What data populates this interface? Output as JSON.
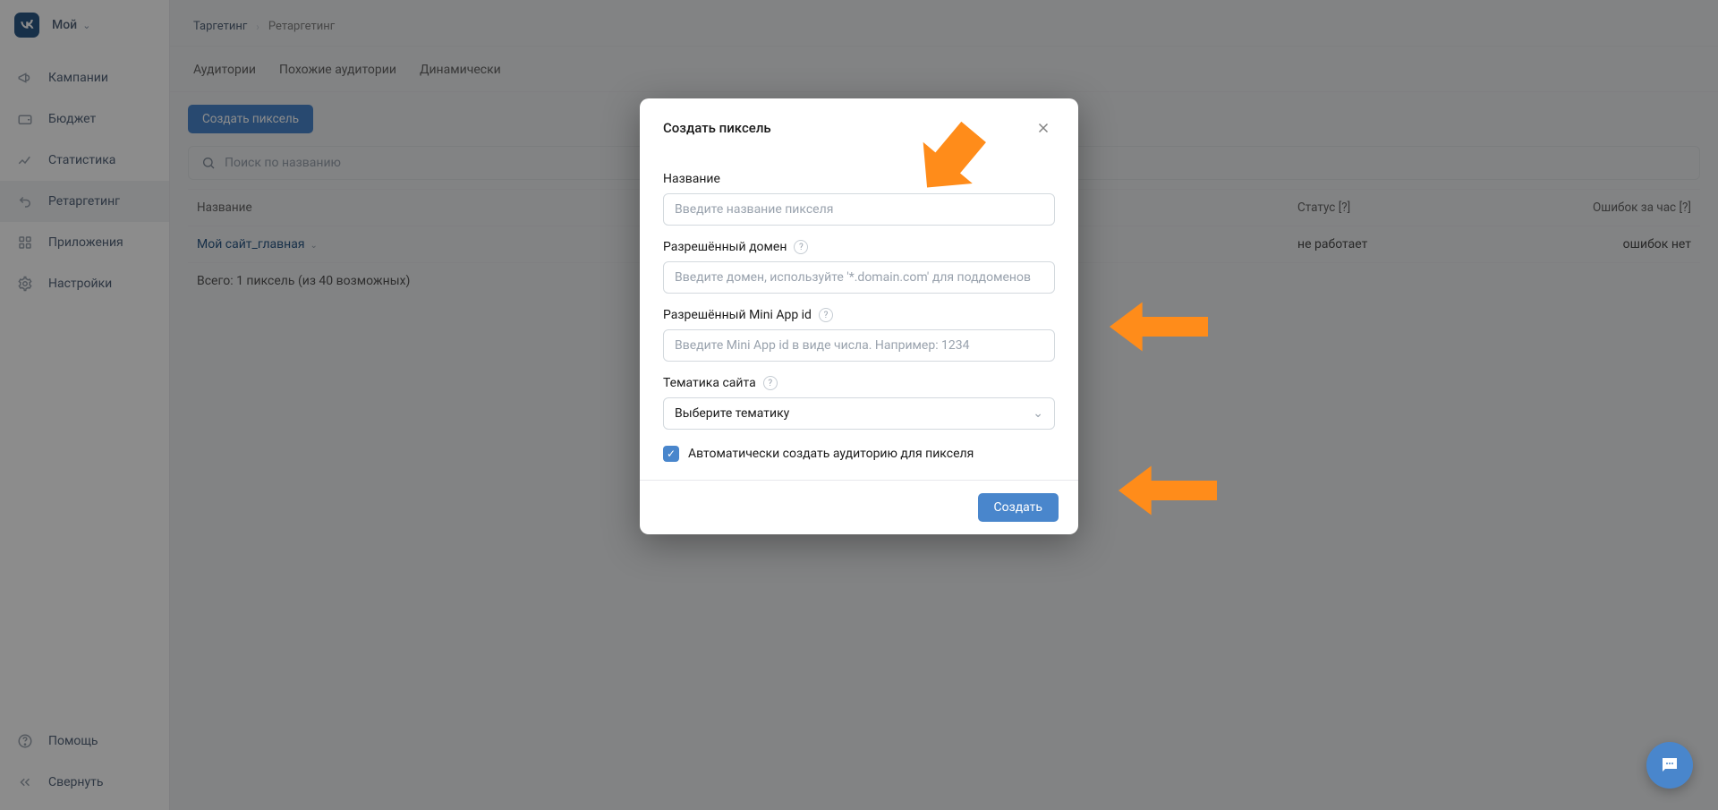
{
  "brand": {
    "label": "Мой"
  },
  "nav": {
    "items": [
      {
        "label": "Кампании",
        "icon": "megaphone-icon"
      },
      {
        "label": "Бюджет",
        "icon": "wallet-icon"
      },
      {
        "label": "Статистика",
        "icon": "chart-icon"
      },
      {
        "label": "Ретаргетинг",
        "icon": "undo-icon"
      },
      {
        "label": "Приложения",
        "icon": "apps-icon"
      },
      {
        "label": "Настройки",
        "icon": "gear-icon"
      }
    ],
    "foot": [
      {
        "label": "Помощь",
        "icon": "help-icon"
      },
      {
        "label": "Свернуть",
        "icon": "collapse-icon"
      }
    ]
  },
  "crumbs": {
    "root": "Таргетинг",
    "leaf": "Ретаргетинг"
  },
  "tabs": {
    "items": [
      {
        "label": "Аудитории"
      },
      {
        "label": "Похожие аудитории"
      },
      {
        "label": "Динамически"
      }
    ]
  },
  "toolbar": {
    "create_pixel": "Создать пиксель"
  },
  "search": {
    "placeholder": "Поиск по названию"
  },
  "table": {
    "head": {
      "name": "Название",
      "status": "Статус [?]",
      "errors": "Ошибок за час [?]"
    },
    "rows": [
      {
        "name": "Мой сайт_главная",
        "status": "не работает",
        "errors": "ошибок нет"
      }
    ],
    "footer": "Всего: 1 пиксель (из 40 возможных)"
  },
  "modal": {
    "title": "Создать пиксель",
    "fields": {
      "name": {
        "label": "Название",
        "placeholder": "Введите название пикселя"
      },
      "domain": {
        "label": "Разрешённый домен",
        "placeholder": "Введите домен, используйте '*.domain.com' для поддоменов"
      },
      "miniapp": {
        "label": "Разрешённый Mini App id",
        "placeholder": "Введите Mini App id в виде числа. Например: 1234"
      },
      "topic": {
        "label": "Тематика сайта",
        "selected": "Выберите тематику"
      }
    },
    "checkbox": {
      "label": "Автоматически создать аудиторию для пикселя",
      "checked": true
    },
    "submit": "Создать"
  }
}
